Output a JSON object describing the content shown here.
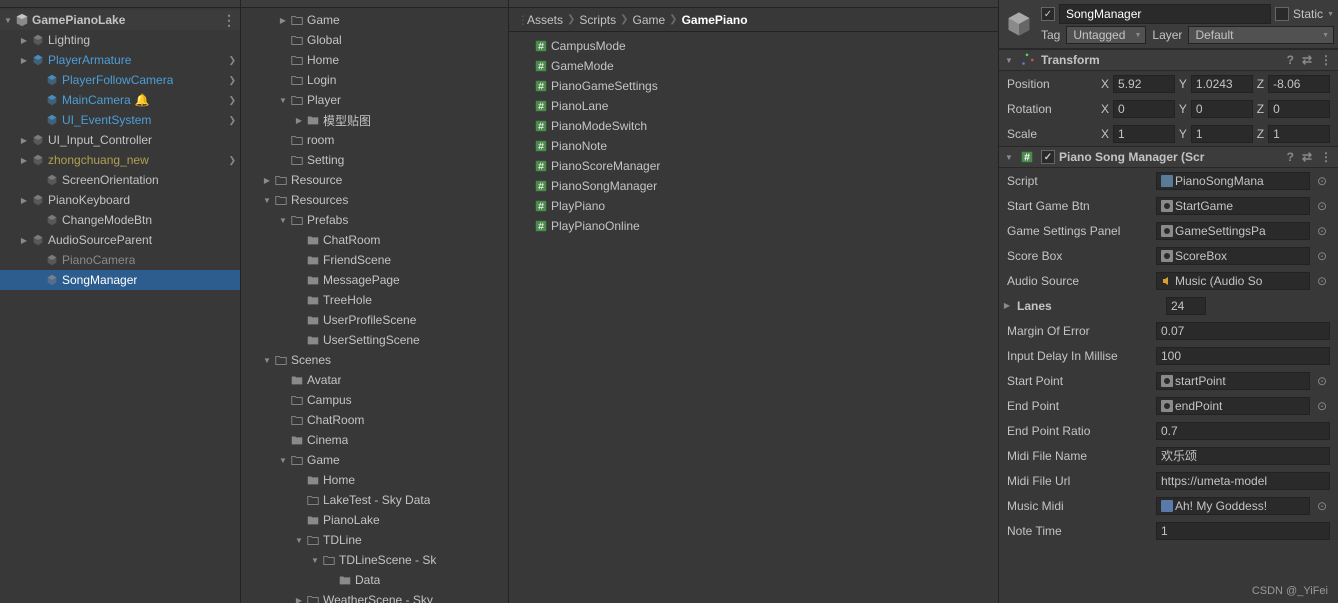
{
  "hierarchy": {
    "scene": "GamePianoLake",
    "items": [
      {
        "indent": 1,
        "fold": "closed",
        "icon": "cube",
        "label": "Lighting",
        "chev": false
      },
      {
        "indent": 1,
        "fold": "closed",
        "icon": "cube-blue",
        "label": "PlayerArmature",
        "blue": true,
        "chev": true
      },
      {
        "indent": 2,
        "fold": "",
        "icon": "cube-blue",
        "label": "PlayerFollowCamera",
        "blue": true,
        "chev": true
      },
      {
        "indent": 2,
        "fold": "",
        "icon": "cube-blue",
        "label": "MainCamera",
        "blue": true,
        "chev": true,
        "alert": true
      },
      {
        "indent": 2,
        "fold": "",
        "icon": "cube-blue",
        "label": "UI_EventSystem",
        "blue": true,
        "chev": true
      },
      {
        "indent": 1,
        "fold": "closed",
        "icon": "cube",
        "label": "UI_Input_Controller",
        "chev": false
      },
      {
        "indent": 1,
        "fold": "closed",
        "icon": "cube",
        "label": "zhongchuang_new",
        "yellow": true,
        "chev": true
      },
      {
        "indent": 2,
        "fold": "",
        "icon": "cube",
        "label": "ScreenOrientation",
        "chev": false
      },
      {
        "indent": 1,
        "fold": "closed",
        "icon": "cube",
        "label": "PianoKeyboard",
        "chev": false
      },
      {
        "indent": 2,
        "fold": "",
        "icon": "cube",
        "label": "ChangeModeBtn",
        "chev": false
      },
      {
        "indent": 1,
        "fold": "closed",
        "icon": "cube",
        "label": "AudioSourceParent",
        "chev": false
      },
      {
        "indent": 2,
        "fold": "",
        "icon": "cube",
        "label": "PianoCamera",
        "gray": true,
        "chev": false
      },
      {
        "indent": 2,
        "fold": "",
        "icon": "cube",
        "label": "SongManager",
        "selected": true,
        "chev": false
      }
    ]
  },
  "project": [
    {
      "indent": 2,
      "fold": "closed",
      "icon": "folder",
      "label": "Game"
    },
    {
      "indent": 2,
      "fold": "",
      "icon": "folder",
      "label": "Global"
    },
    {
      "indent": 2,
      "fold": "",
      "icon": "folder",
      "label": "Home"
    },
    {
      "indent": 2,
      "fold": "",
      "icon": "folder-empty",
      "label": "Login"
    },
    {
      "indent": 2,
      "fold": "open",
      "icon": "folder",
      "label": "Player"
    },
    {
      "indent": 3,
      "fold": "closed",
      "icon": "folder-solid",
      "label": "模型贴图"
    },
    {
      "indent": 2,
      "fold": "",
      "icon": "folder-empty",
      "label": "room"
    },
    {
      "indent": 2,
      "fold": "",
      "icon": "folder-empty",
      "label": "Setting"
    },
    {
      "indent": 1,
      "fold": "closed",
      "icon": "folder",
      "label": "Resource"
    },
    {
      "indent": 1,
      "fold": "open",
      "icon": "folder",
      "label": "Resources"
    },
    {
      "indent": 2,
      "fold": "open",
      "icon": "folder",
      "label": "Prefabs"
    },
    {
      "indent": 3,
      "fold": "",
      "icon": "folder-solid",
      "label": "ChatRoom"
    },
    {
      "indent": 3,
      "fold": "",
      "icon": "folder-solid",
      "label": "FriendScene"
    },
    {
      "indent": 3,
      "fold": "",
      "icon": "folder-solid",
      "label": "MessagePage"
    },
    {
      "indent": 3,
      "fold": "",
      "icon": "folder-solid",
      "label": "TreeHole"
    },
    {
      "indent": 3,
      "fold": "",
      "icon": "folder-solid",
      "label": "UserProfileScene"
    },
    {
      "indent": 3,
      "fold": "",
      "icon": "folder-solid",
      "label": "UserSettingScene"
    },
    {
      "indent": 1,
      "fold": "open",
      "icon": "folder",
      "label": "Scenes"
    },
    {
      "indent": 2,
      "fold": "",
      "icon": "folder-solid",
      "label": "Avatar"
    },
    {
      "indent": 2,
      "fold": "",
      "icon": "folder-empty",
      "label": "Campus"
    },
    {
      "indent": 2,
      "fold": "",
      "icon": "folder-empty",
      "label": "ChatRoom"
    },
    {
      "indent": 2,
      "fold": "",
      "icon": "folder-solid",
      "label": "Cinema"
    },
    {
      "indent": 2,
      "fold": "open",
      "icon": "folder",
      "label": "Game"
    },
    {
      "indent": 3,
      "fold": "",
      "icon": "folder-solid",
      "label": "Home"
    },
    {
      "indent": 3,
      "fold": "",
      "icon": "folder-empty",
      "label": "LakeTest - Sky Data"
    },
    {
      "indent": 3,
      "fold": "",
      "icon": "folder-solid",
      "label": "PianoLake"
    },
    {
      "indent": 3,
      "fold": "open",
      "icon": "folder",
      "label": "TDLine"
    },
    {
      "indent": 4,
      "fold": "open",
      "icon": "folder",
      "label": "TDLineScene - Sk"
    },
    {
      "indent": 5,
      "fold": "",
      "icon": "folder-solid",
      "label": "Data"
    },
    {
      "indent": 3,
      "fold": "closed",
      "icon": "folder",
      "label": "WeatherScene - Sky"
    }
  ],
  "breadcrumb": [
    "Assets",
    "Scripts",
    "Game",
    "GamePiano"
  ],
  "assets": [
    "CampusMode",
    "GameMode",
    "PianoGameSettings",
    "PianoLane",
    "PianoModeSwitch",
    "PianoNote",
    "PianoScoreManager",
    "PianoSongManager",
    "PlayPiano",
    "PlayPianoOnline"
  ],
  "inspector": {
    "name": "SongManager",
    "enabled": true,
    "static_label": "Static",
    "tag_label": "Tag",
    "tag_value": "Untagged",
    "layer_label": "Layer",
    "layer_value": "Default",
    "transform": {
      "title": "Transform",
      "position_label": "Position",
      "rotation_label": "Rotation",
      "scale_label": "Scale",
      "position": {
        "x": "5.92",
        "y": "1.0243",
        "z": "-8.06"
      },
      "rotation": {
        "x": "0",
        "y": "0",
        "z": "0"
      },
      "scale": {
        "x": "1",
        "y": "1",
        "z": "1"
      }
    },
    "component": {
      "title": "Piano Song Manager (Scr",
      "props": [
        {
          "label": "Script",
          "type": "obj",
          "icon": "script",
          "value": "PianoSongMana",
          "picker": true,
          "gray": true
        },
        {
          "label": "Start Game Btn",
          "type": "obj",
          "icon": "ui",
          "value": "StartGame",
          "picker": true
        },
        {
          "label": "Game Settings Panel",
          "type": "obj",
          "icon": "ui",
          "value": "GameSettingsPa",
          "picker": true
        },
        {
          "label": "Score Box",
          "type": "obj",
          "icon": "ui",
          "value": "ScoreBox",
          "picker": true
        },
        {
          "label": "Audio Source",
          "type": "obj",
          "icon": "audio",
          "value": "Music (Audio So",
          "picker": true
        },
        {
          "label": "Lanes",
          "type": "array",
          "value": "24",
          "fold": true
        },
        {
          "label": "Margin Of Error",
          "type": "text",
          "value": "0.07"
        },
        {
          "label": "Input Delay In Millise",
          "type": "text",
          "value": "100"
        },
        {
          "label": "Start Point",
          "type": "obj",
          "icon": "ui",
          "value": "startPoint",
          "picker": true
        },
        {
          "label": "End Point",
          "type": "obj",
          "icon": "ui",
          "value": "endPoint",
          "picker": true
        },
        {
          "label": "End Point Ratio",
          "type": "text",
          "value": "0.7"
        },
        {
          "label": "Midi File Name",
          "type": "text",
          "value": "欢乐颂"
        },
        {
          "label": "Midi File Url",
          "type": "text",
          "value": "https://umeta-model"
        },
        {
          "label": "Music Midi",
          "type": "obj",
          "icon": "asset",
          "value": "Ah! My Goddess!",
          "picker": true
        },
        {
          "label": "Note Time",
          "type": "text",
          "value": "1"
        }
      ]
    }
  },
  "watermark": "CSDN @_YiFei"
}
